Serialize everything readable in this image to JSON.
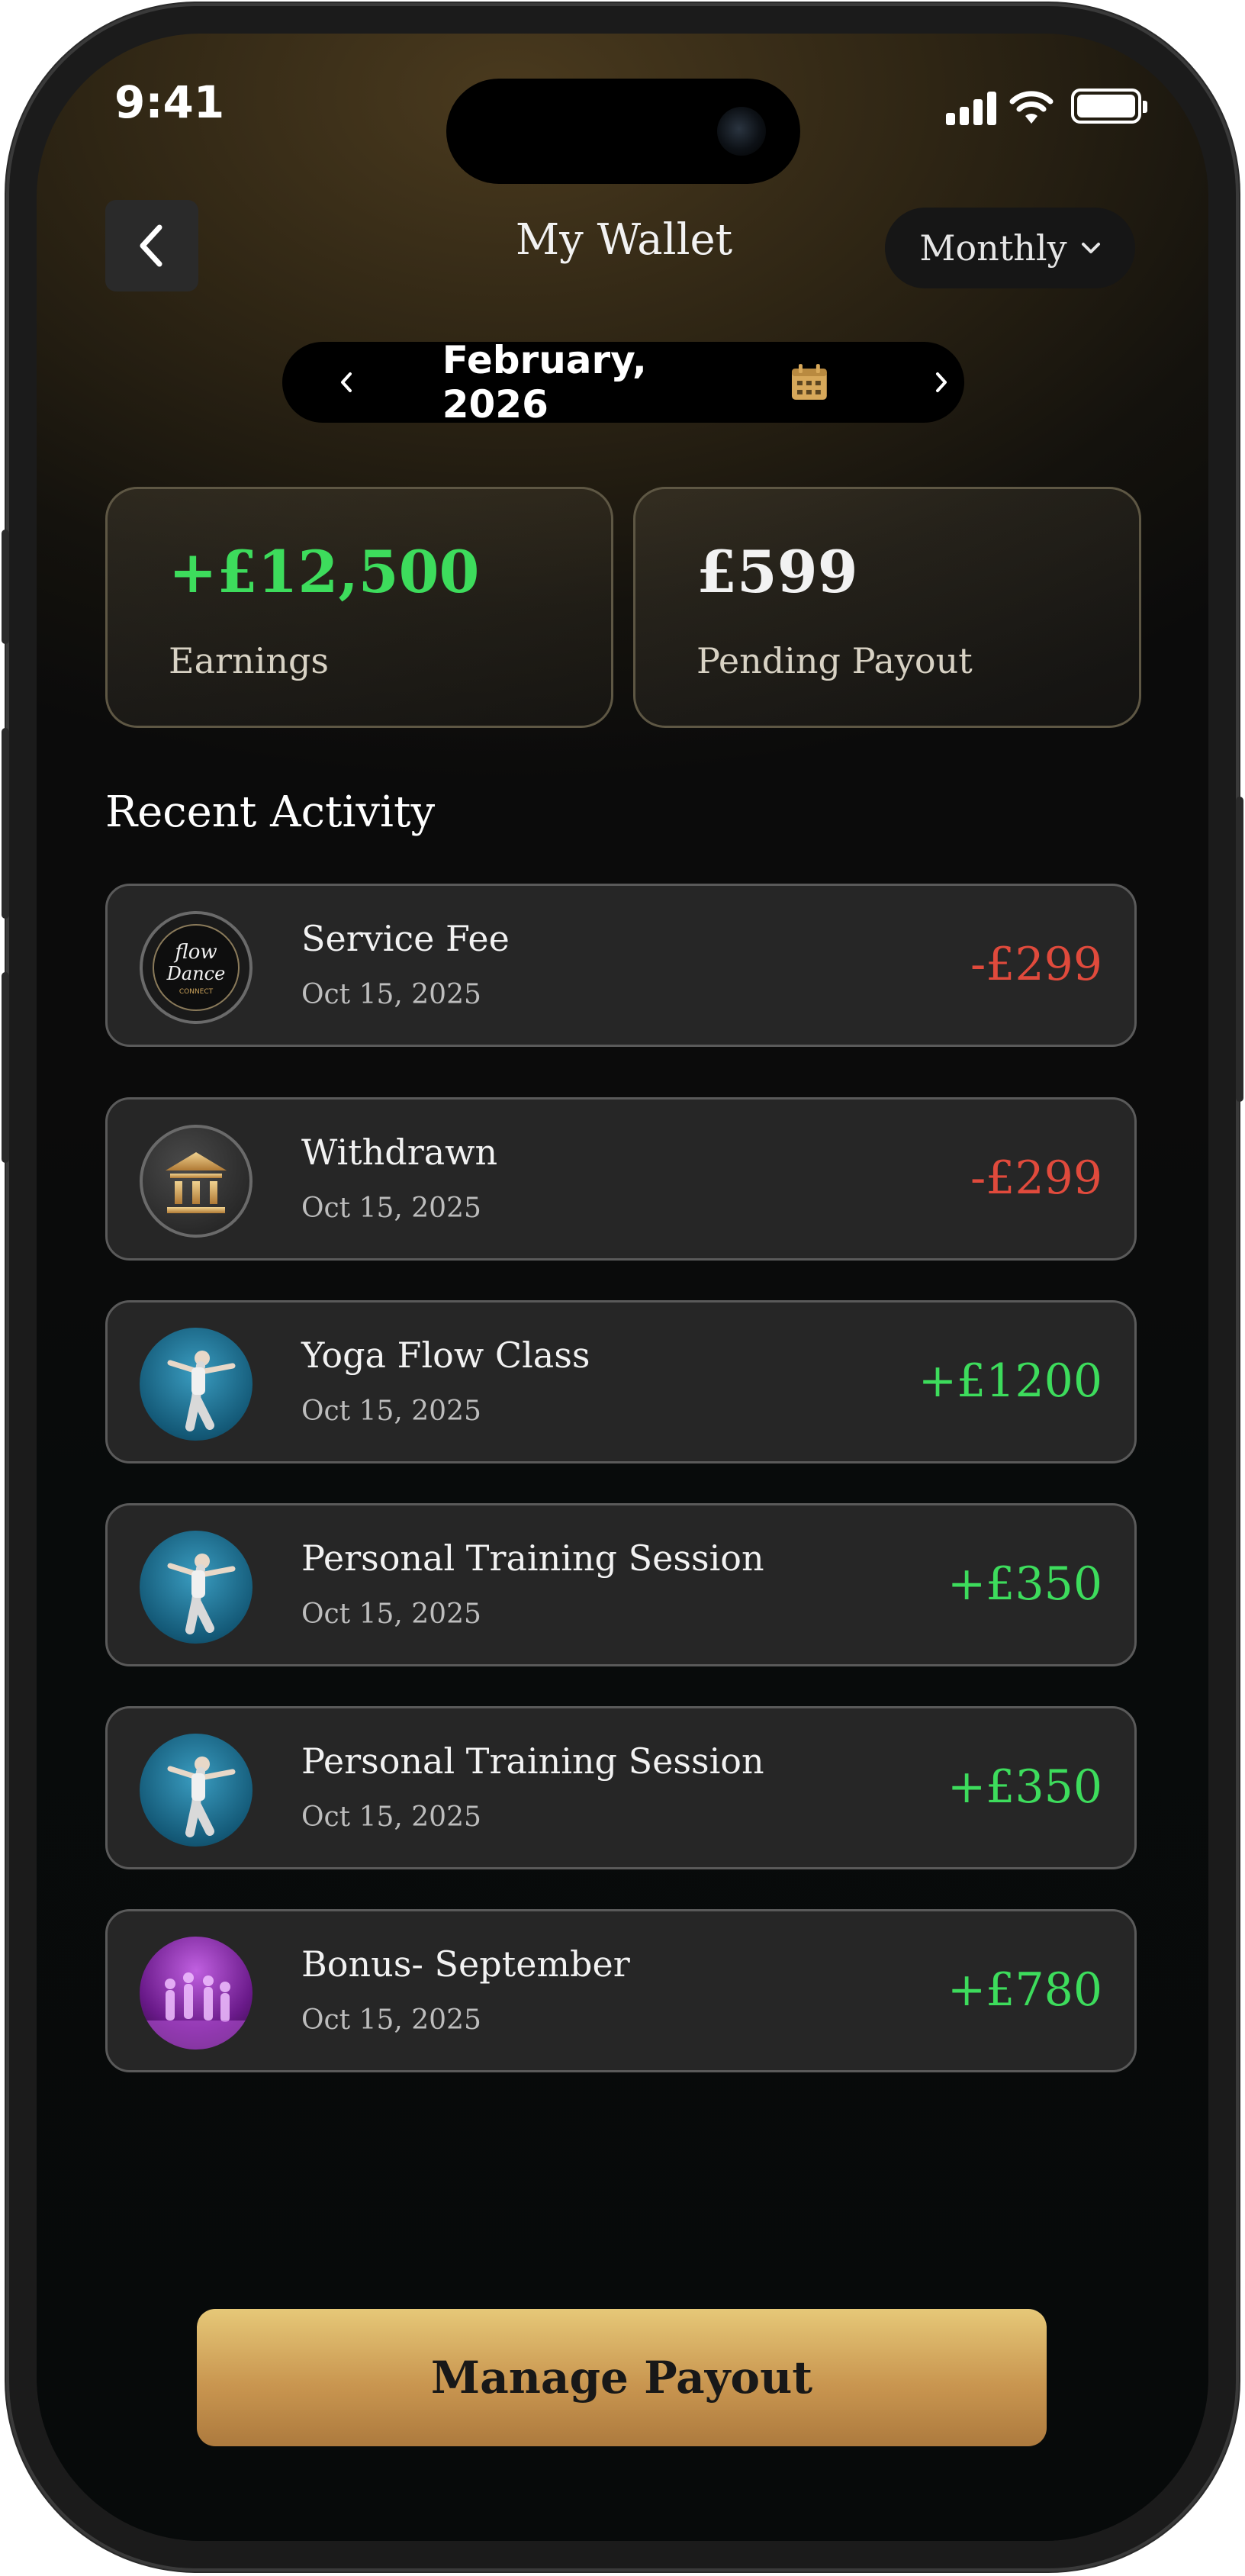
{
  "status_bar": {
    "time": "9:41"
  },
  "header": {
    "title": "My Wallet",
    "period_selector": "Monthly"
  },
  "month_nav": {
    "label": "February, 2026"
  },
  "stats": {
    "earnings": {
      "value": "+£12,500",
      "label": "Earnings"
    },
    "pending": {
      "value": "£599",
      "label": "Pending Payout"
    }
  },
  "recent_activity": {
    "title": "Recent Activity",
    "items": [
      {
        "title": "Service Fee",
        "date": "Oct 15, 2025",
        "amount": "-£299",
        "type": "debit",
        "icon": "flow-dance-connect-logo"
      },
      {
        "title": "Withdrawn",
        "date": "Oct 15, 2025",
        "amount": "-£299",
        "type": "debit",
        "icon": "bank-icon"
      },
      {
        "title": "Yoga Flow Class",
        "date": "Oct 15, 2025",
        "amount": "+£1200",
        "type": "credit",
        "icon": "dancer-photo"
      },
      {
        "title": "Personal Training Session",
        "date": "Oct 15, 2025",
        "amount": "+£350",
        "type": "credit",
        "icon": "dancer-photo"
      },
      {
        "title": "Personal Training Session",
        "date": "Oct 15, 2025",
        "amount": "+£350",
        "type": "credit",
        "icon": "dancer-photo"
      },
      {
        "title": "Bonus- September",
        "date": "Oct 15, 2025",
        "amount": "+£780",
        "type": "credit",
        "icon": "dance-group-photo"
      }
    ]
  },
  "cta": {
    "label": "Manage Payout"
  },
  "colors": {
    "credit": "#3ddc5c",
    "debit": "#e04a3c",
    "gold": "#c99650"
  },
  "logo_text": {
    "line1": "flow",
    "line2": "Dance",
    "line3": "CONNECT"
  }
}
